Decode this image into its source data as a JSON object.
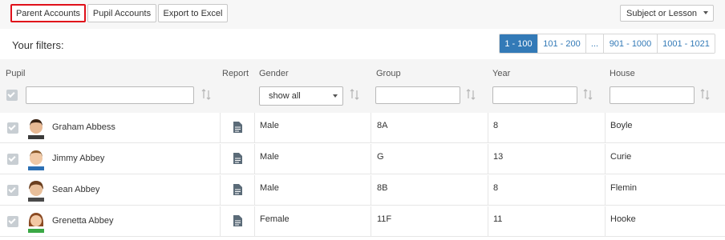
{
  "toolbar": {
    "parent_accounts": "Parent Accounts",
    "pupil_accounts": "Pupil Accounts",
    "export_excel": "Export to Excel",
    "subject_select": "Subject or Lesson"
  },
  "filters": {
    "label": "Your filters:"
  },
  "pagination": [
    "1 - 100",
    "101 - 200",
    "...",
    "901 - 1000",
    "1001 - 1021"
  ],
  "columns": {
    "pupil": "Pupil",
    "report": "Report",
    "gender": "Gender",
    "group": "Group",
    "year": "Year",
    "house": "House"
  },
  "gender_filter": {
    "selected": "show all"
  },
  "rows": [
    {
      "name": "Graham Abbess",
      "gender": "Male",
      "group": "8A",
      "year": "8",
      "house": "Boyle"
    },
    {
      "name": "Jimmy Abbey",
      "gender": "Male",
      "group": "G",
      "year": "13",
      "house": "Curie"
    },
    {
      "name": "Sean Abbey",
      "gender": "Male",
      "group": "8B",
      "year": "8",
      "house": "Flemin"
    },
    {
      "name": "Grenetta Abbey",
      "gender": "Female",
      "group": "11F",
      "year": "11",
      "house": "Hooke"
    }
  ],
  "colors": {
    "accent": "#337ab7",
    "highlight": "#e0101a",
    "checkbox": "#c8ced3"
  }
}
